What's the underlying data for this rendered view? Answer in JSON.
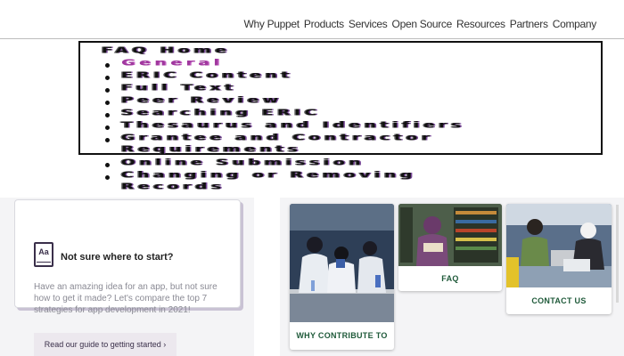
{
  "nav": {
    "links": [
      "Why Puppet",
      "Products",
      "Services",
      "Open Source",
      "Resources",
      "Partners",
      "Company"
    ]
  },
  "faq": {
    "home": "FAQ Home",
    "items": [
      "General",
      "ERIC Content",
      "Full Text",
      "Peer Review",
      "Searching ERIC",
      "Thesaurus and Identifiers",
      "Grantee and Contractor",
      "Requirements",
      "Online Submission",
      "Changing or Removing",
      "Records"
    ],
    "active_color": "#a0379e"
  },
  "card": {
    "icon_text": "Aa",
    "title": "Not sure where to start?",
    "body": "Have an amazing idea for an app, but not sure how to get it made? Let's compare the top 7 strategies for app development in 2021!",
    "button": "Read our guide to getting started ›"
  },
  "gallery": {
    "tiles": [
      {
        "label": "WHY CONTRIBUTE TO HU?",
        "icon": "lab-photo"
      },
      {
        "label": "FAQ",
        "icon": "library-photo"
      },
      {
        "label": "CONTACT US",
        "icon": "study-photo"
      }
    ],
    "label_color": "#1f5a3a"
  }
}
